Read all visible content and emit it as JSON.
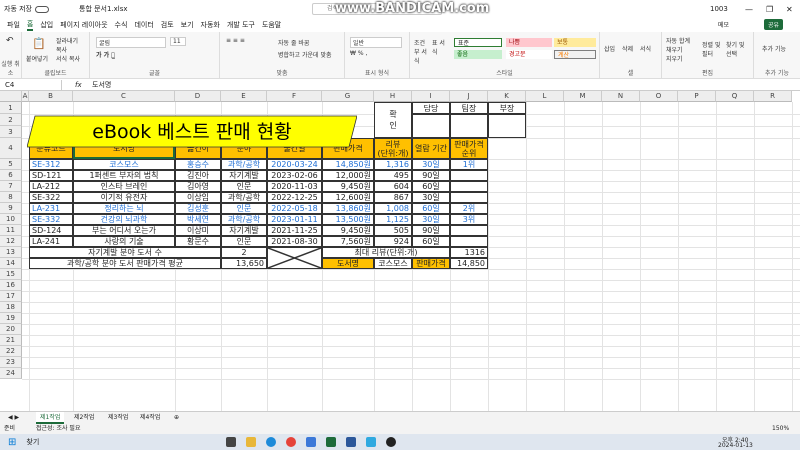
{
  "titlebar": {
    "autosave": "자동 저장",
    "file_name": "통합 문서1.xlsx",
    "search_placeholder": "검색",
    "watermark": "www.BANDICAM.com",
    "user": "1003"
  },
  "menu": [
    "파일",
    "홈",
    "삽입",
    "페이지 레이아웃",
    "수식",
    "데이터",
    "검토",
    "보기",
    "자동화",
    "개발 도구",
    "도움말"
  ],
  "ribbon": {
    "groups": [
      "실행 취소",
      "클립보드",
      "글꼴",
      "맞춤",
      "표시 형식",
      "스타일",
      "셀",
      "편집",
      "추가 기능"
    ],
    "paste": "붙여넣기",
    "cut": "잘라내기",
    "copy": "복사",
    "format_painter": "서식 복사",
    "font_name": "굴림",
    "font_size": "11",
    "wrap": "자동 줄 바꿈",
    "merge": "병합하고 가운데 맞춤",
    "number_format": "일반",
    "styles": [
      "표준",
      "나쁨",
      "보통",
      "좋음",
      "경고문",
      "계산"
    ],
    "cond_format": "조건부 서식",
    "table_format": "표 서식",
    "insert": "삽입",
    "delete": "삭제",
    "format": "서식",
    "autosum": "자동 합계",
    "fill": "채우기",
    "clear": "지우기",
    "sort": "정렬 및 필터",
    "find": "찾기 및 선택",
    "addins": "추가 기능",
    "comment": "메모",
    "share": "공유"
  },
  "formula": {
    "cell_ref": "C4",
    "fx": "fx",
    "value": "도서명"
  },
  "columns": [
    "A",
    "B",
    "C",
    "D",
    "E",
    "F",
    "G",
    "H",
    "I",
    "J",
    "K",
    "L",
    "M",
    "N",
    "O",
    "P",
    "Q",
    "R"
  ],
  "rows": [
    "1",
    "2",
    "3",
    "4",
    "5",
    "6",
    "7",
    "8",
    "9",
    "10",
    "11",
    "12",
    "13",
    "14",
    "15",
    "16",
    "17",
    "18",
    "19",
    "20",
    "21",
    "22",
    "23",
    "24"
  ],
  "title": "eBook 베스트 판매 현황",
  "approval": {
    "label": "확\n인",
    "cols": [
      "담당",
      "팀장",
      "부장"
    ]
  },
  "headers": [
    "분류코드",
    "도서명",
    "옮긴이",
    "분야",
    "출간일",
    "판매가격",
    "리뷰\n(단위:개)",
    "열람 기간",
    "판매가격\n순위"
  ],
  "records": [
    [
      "SE-312",
      "코스모스",
      "홍승수",
      "과학/공학",
      "2020-03-24",
      "14,850원",
      "1,316",
      "30일",
      "1위"
    ],
    [
      "SD-121",
      "1퍼센트 부자의 법칙",
      "김진아",
      "자기계발",
      "2023-02-06",
      "12,000원",
      "495",
      "90일",
      ""
    ],
    [
      "LA-212",
      "인스타 브레인",
      "김아영",
      "인문",
      "2020-11-03",
      "9,450원",
      "604",
      "60일",
      ""
    ],
    [
      "SE-322",
      "이기적 유전자",
      "이상임",
      "과학/공학",
      "2022-12-25",
      "12,600원",
      "867",
      "30일",
      ""
    ],
    [
      "LA-231",
      "정리하는 뇌",
      "김성훈",
      "인문",
      "2022-05-18",
      "13,860원",
      "1,008",
      "60일",
      "2위"
    ],
    [
      "SE-332",
      "건강의 뇌과학",
      "박세연",
      "과학/공학",
      "2023-01-11",
      "13,500원",
      "1,125",
      "30일",
      "3위"
    ],
    [
      "SD-124",
      "부는 어디서 오는가",
      "이상미",
      "자기계발",
      "2021-11-25",
      "9,450원",
      "505",
      "90일",
      ""
    ],
    [
      "LA-241",
      "사랑의 기술",
      "황문수",
      "인문",
      "2021-08-30",
      "7,560원",
      "924",
      "60일",
      ""
    ]
  ],
  "summary": {
    "label1": "자기계발 분야 도서 수",
    "val1": "2",
    "label2": "과학/공학 분야 도서 판매가격 평균",
    "val2": "13,650",
    "maxlabel": "최대 리뷰(단위:개)",
    "maxval": "1316",
    "book_label": "도서명",
    "book_val": "코스모스",
    "price_label": "판매가격",
    "price_val": "14,850"
  },
  "sheets": [
    "제1작업",
    "제2작업",
    "제3작업",
    "제4작업"
  ],
  "status": {
    "ready": "준비",
    "accessibility": "접근성: 조사 필요",
    "zoom": "150%"
  },
  "taskbar": {
    "search": "찾기",
    "time": "오후 2:40",
    "date": "2024-01-13"
  }
}
